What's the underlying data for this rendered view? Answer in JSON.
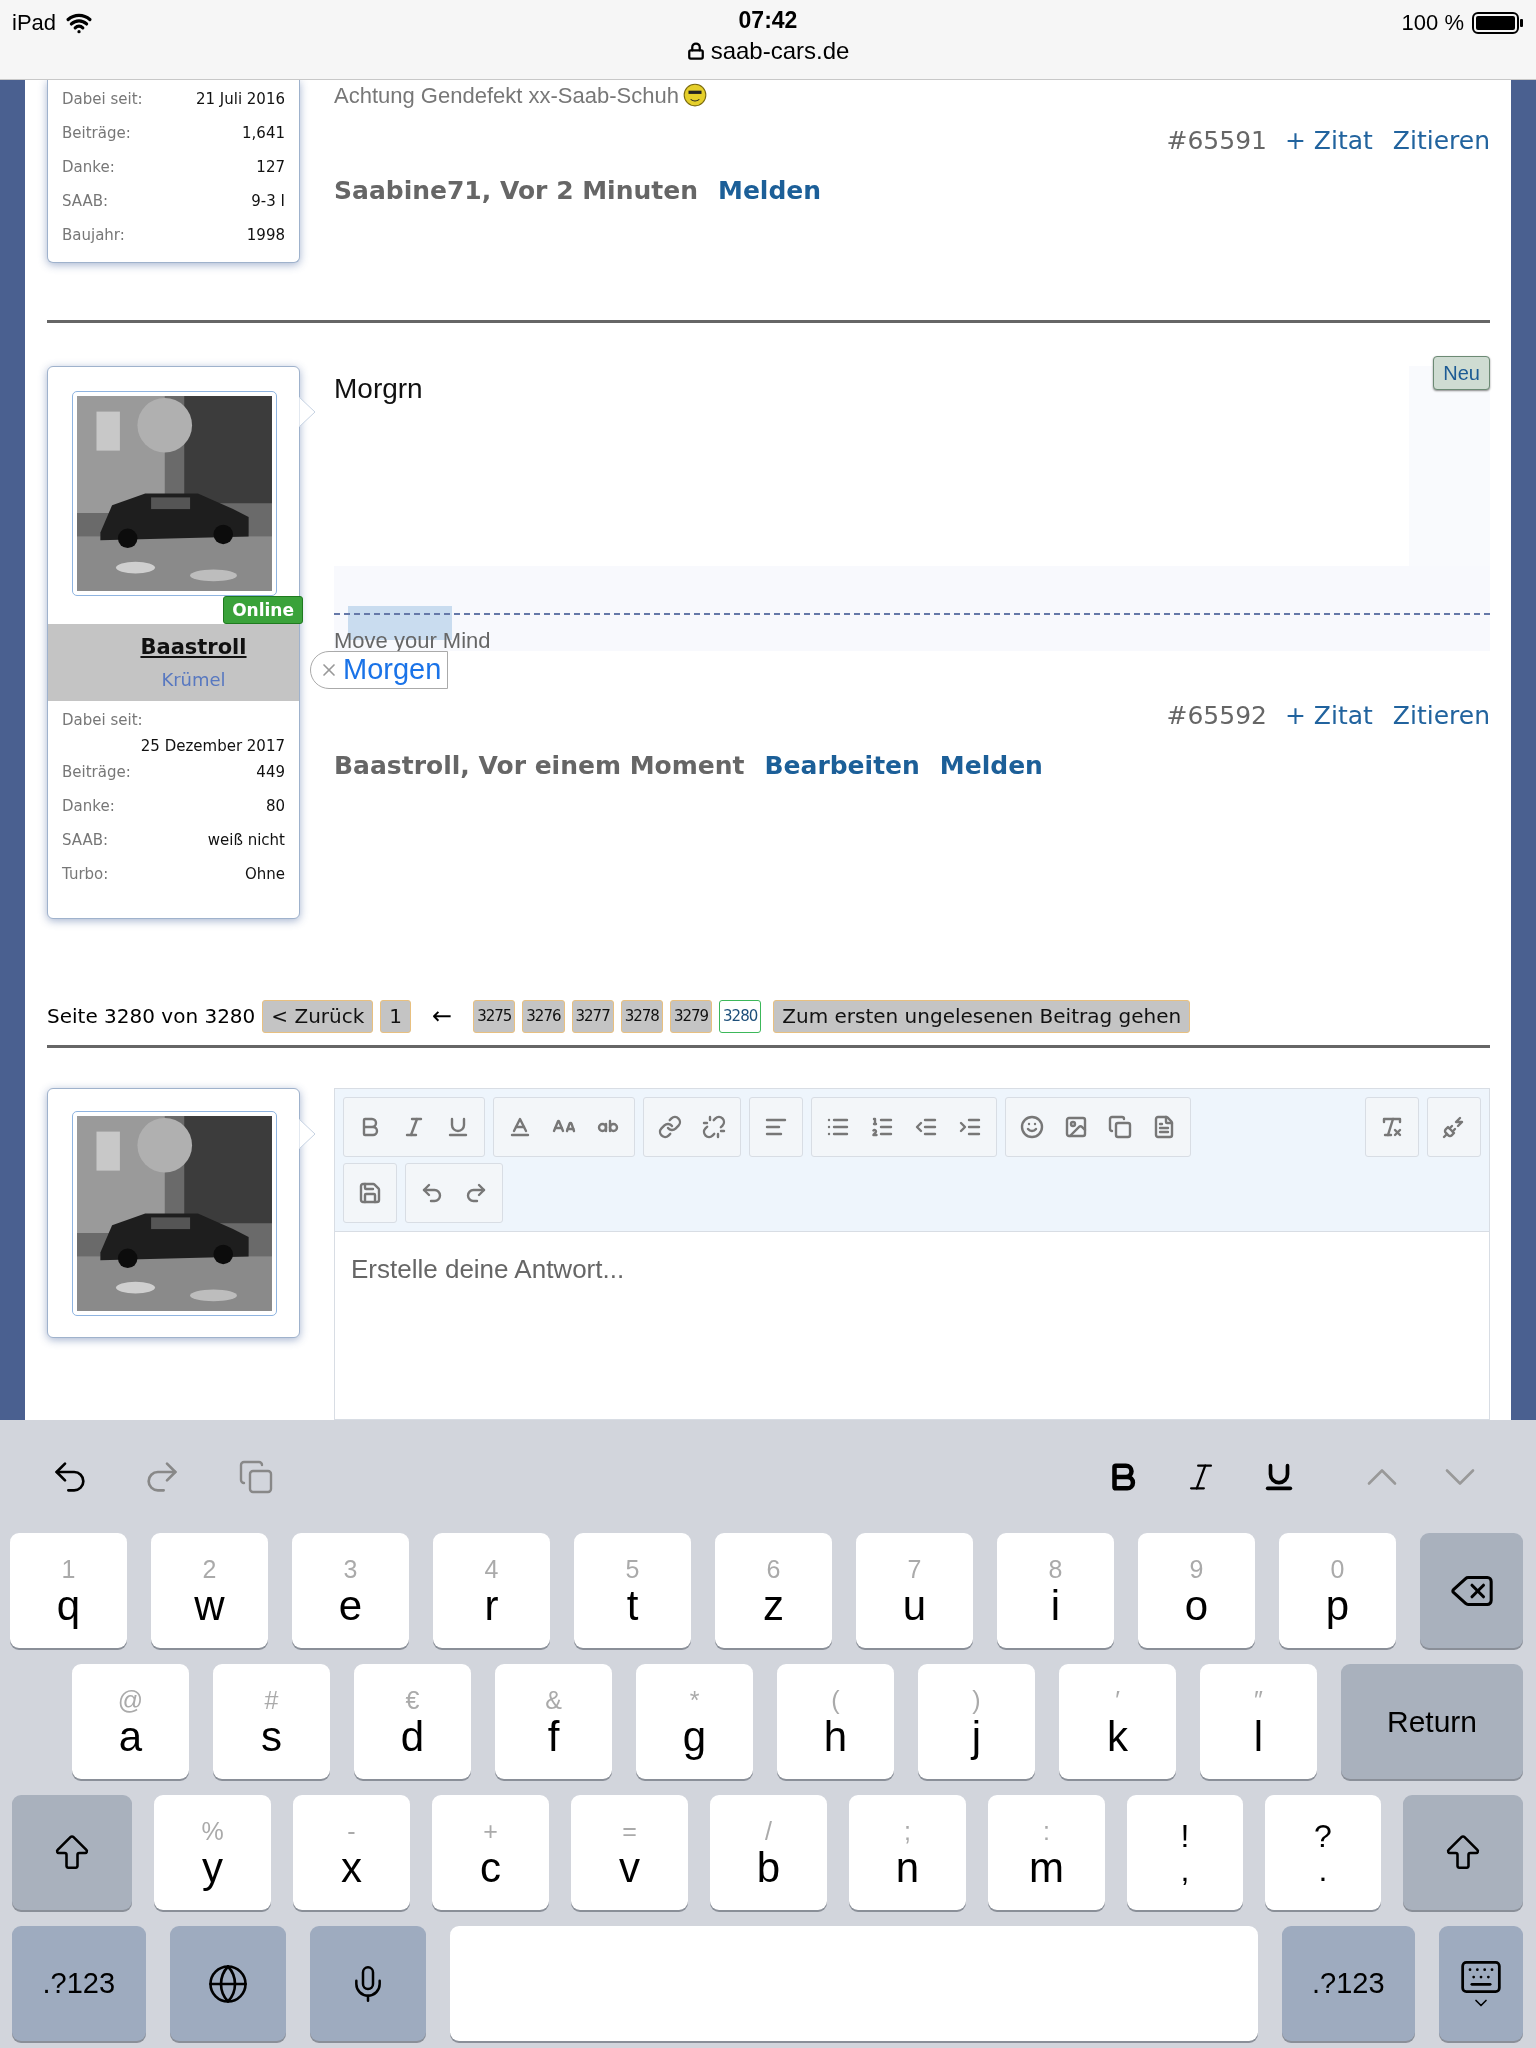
{
  "status_bar": {
    "device": "iPad",
    "time": "07:42",
    "url": "saab-cars.de",
    "battery": "100 %"
  },
  "posts": [
    {
      "author": {
        "stats": [
          {
            "label": "Dabei seit:",
            "value": "21 Juli 2016"
          },
          {
            "label": "Beiträge:",
            "value": "1,641"
          },
          {
            "label": "Danke:",
            "value": "127"
          },
          {
            "label": "SAAB:",
            "value": "9-3 I"
          },
          {
            "label": "Baujahr:",
            "value": "1998"
          }
        ]
      },
      "message": "Achtung Gendefekt xx-Saab-Schuh",
      "post_number": "#65591",
      "quote_actions": [
        "+ Zitat",
        "Zitieren"
      ],
      "byline": "Saabine71, Vor 2 Minuten",
      "byline_links": [
        "Melden"
      ]
    },
    {
      "author": {
        "username": "Baastroll",
        "rank": "Krümel",
        "status": "Online",
        "stats": [
          {
            "label": "Dabei seit:",
            "value": "25 Dezember 2017"
          },
          {
            "label": "Beiträge:",
            "value": "449"
          },
          {
            "label": "Danke:",
            "value": "80"
          },
          {
            "label": "SAAB:",
            "value": "weiß nicht"
          },
          {
            "label": "Turbo:",
            "value": "Ohne"
          }
        ]
      },
      "badge": "Neu",
      "message": "Morgrn",
      "signature": "Move your Mind",
      "autocorrect": "Morgen",
      "post_number": "#65592",
      "quote_actions": [
        "+ Zitat",
        "Zitieren"
      ],
      "byline": "Baastroll, Vor einem Moment",
      "byline_links": [
        "Bearbeiten",
        "Melden"
      ]
    }
  ],
  "pagination": {
    "label": "Seite 3280 von 3280",
    "buttons": [
      "< Zurück",
      "1"
    ],
    "separator": "←",
    "pages": [
      {
        "label": "3275",
        "selected": false
      },
      {
        "label": "3276",
        "selected": false
      },
      {
        "label": "3277",
        "selected": false
      },
      {
        "label": "3278",
        "selected": false
      },
      {
        "label": "3279",
        "selected": false
      },
      {
        "label": "3280",
        "selected": true
      }
    ],
    "unread_button": "Zum ersten ungelesenen Beitrag gehen"
  },
  "reply": {
    "placeholder": "Erstelle deine Antwort..."
  },
  "keyboard": {
    "top_row": [
      {
        "kind": "letter",
        "label": "q",
        "hint": "1"
      },
      {
        "kind": "letter",
        "label": "w",
        "hint": "2"
      },
      {
        "kind": "letter",
        "label": "e",
        "hint": "3"
      },
      {
        "kind": "letter",
        "label": "r",
        "hint": "4"
      },
      {
        "kind": "letter",
        "label": "t",
        "hint": "5"
      },
      {
        "kind": "letter",
        "label": "z",
        "hint": "6"
      },
      {
        "kind": "letter",
        "label": "u",
        "hint": "7"
      },
      {
        "kind": "letter",
        "label": "i",
        "hint": "8"
      },
      {
        "kind": "letter",
        "label": "o",
        "hint": "9"
      },
      {
        "kind": "letter",
        "label": "p",
        "hint": "0"
      },
      {
        "kind": "backspace"
      }
    ],
    "home_row": [
      {
        "kind": "letter",
        "label": "a",
        "hint": "@"
      },
      {
        "kind": "letter",
        "label": "s",
        "hint": "#"
      },
      {
        "kind": "letter",
        "label": "d",
        "hint": "€"
      },
      {
        "kind": "letter",
        "label": "f",
        "hint": "&"
      },
      {
        "kind": "letter",
        "label": "g",
        "hint": "*"
      },
      {
        "kind": "letter",
        "label": "h",
        "hint": "("
      },
      {
        "kind": "letter",
        "label": "j",
        "hint": ")"
      },
      {
        "kind": "letter",
        "label": "k",
        "hint": "′"
      },
      {
        "kind": "letter",
        "label": "l",
        "hint": "″"
      },
      {
        "kind": "return",
        "label": "Return"
      }
    ],
    "bottom_row": [
      {
        "kind": "shift"
      },
      {
        "kind": "letter",
        "label": "y",
        "hint": "%"
      },
      {
        "kind": "letter",
        "label": "x",
        "hint": "-"
      },
      {
        "kind": "letter",
        "label": "c",
        "hint": "+"
      },
      {
        "kind": "letter",
        "label": "v",
        "hint": "="
      },
      {
        "kind": "letter",
        "label": "b",
        "hint": "/"
      },
      {
        "kind": "letter",
        "label": "n",
        "hint": ";"
      },
      {
        "kind": "letter",
        "label": "m",
        "hint": ":"
      },
      {
        "kind": "punct",
        "label": ",",
        "hint": "!"
      },
      {
        "kind": "punct",
        "label": ".",
        "hint": "?"
      },
      {
        "kind": "shift"
      }
    ],
    "function_row": [
      {
        "kind": "mode",
        "label": ".?123"
      },
      {
        "kind": "globe"
      },
      {
        "kind": "mic"
      },
      {
        "kind": "space"
      },
      {
        "kind": "mode",
        "label": ".?123"
      },
      {
        "kind": "dismiss"
      }
    ]
  }
}
